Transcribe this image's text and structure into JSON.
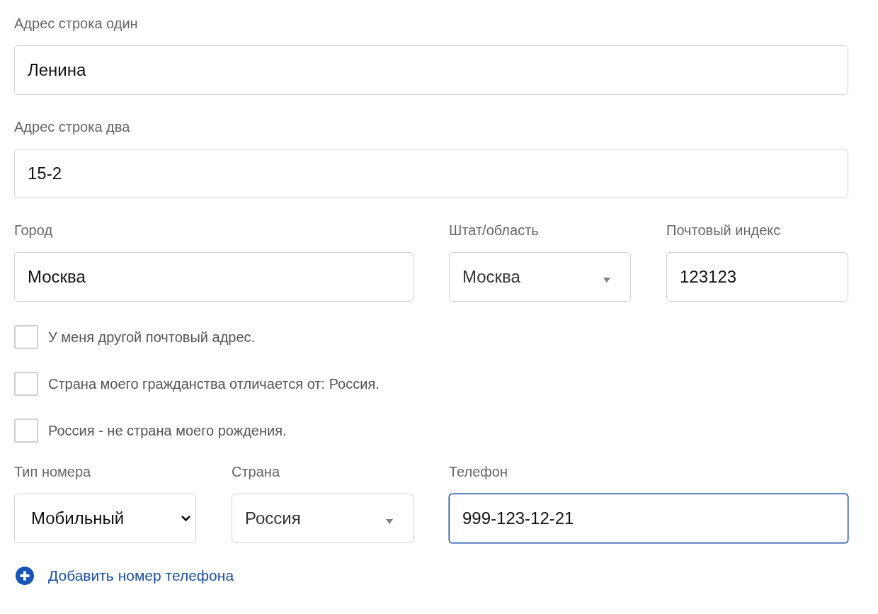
{
  "address_rows": [
    {
      "fields": [
        {
          "label": "Адрес строка один",
          "value": "Ленина",
          "kind": "text",
          "focused": false
        }
      ]
    },
    {
      "fields": [
        {
          "label": "Адрес строка два",
          "value": "15-2",
          "kind": "text",
          "focused": false
        }
      ]
    },
    {
      "fields": [
        {
          "label": "Город",
          "value": "Москва",
          "kind": "text",
          "focused": false
        },
        {
          "label": "Штат/область",
          "value": "Москва",
          "kind": "select",
          "focused": false
        },
        {
          "label": "Почтовый индекс",
          "value": "123123",
          "kind": "text",
          "focused": false
        }
      ]
    }
  ],
  "checkboxes": [
    {
      "label": "У меня другой почтовый адрес.",
      "checked": false
    },
    {
      "label": "Страна моего гражданства отличается от: Россия.",
      "checked": false
    },
    {
      "label": "Россия - не страна моего рождения.",
      "checked": false
    }
  ],
  "phone_row": {
    "fields": [
      {
        "label": "Тип номера",
        "value": "Мобильный",
        "kind": "native-select",
        "focused": false
      },
      {
        "label": "Страна",
        "value": "Россия",
        "kind": "select",
        "focused": false
      },
      {
        "label": "Телефон",
        "value": "999-123-12-21",
        "kind": "text",
        "focused": true
      }
    ]
  },
  "add_phone_link": "Добавить номер телефона"
}
